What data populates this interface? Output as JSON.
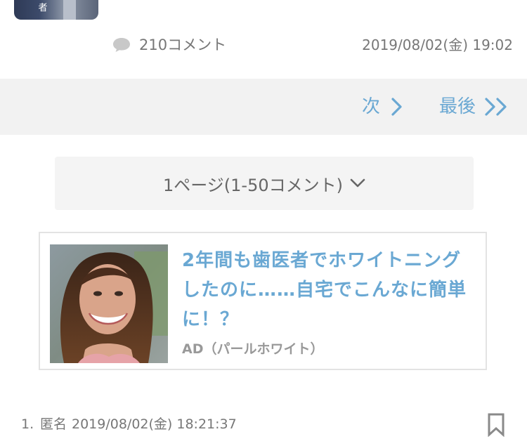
{
  "article": {
    "thumb_glyph": "者",
    "comment_count": "210コメント",
    "date": "2019/08/02(金) 19:02",
    "comment_icon": "speech-bubble-icon"
  },
  "pager": {
    "next_label": "次",
    "last_label": "最後",
    "accent_color": "#6aa8d3",
    "band_color": "#f2f2f2"
  },
  "page_select": {
    "label": "1ページ(1-50コメント)",
    "icon": "chevron-down-icon"
  },
  "ad": {
    "title": "2年間も歯医者でホワイトニングしたのに……自宅でこんなに簡単に！？",
    "source": "AD（パールホワイト）",
    "title_color": "#6aa8d3"
  },
  "comments": [
    {
      "number": "1.",
      "author": "匿名",
      "timestamp": "2019/08/02(金) 18:21:37",
      "bookmark_icon": "bookmark-icon"
    }
  ]
}
